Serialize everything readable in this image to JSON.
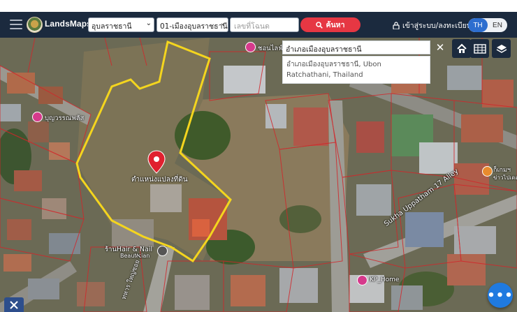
{
  "header": {
    "brand": "LandsMaps",
    "province": "อุบลราชธานี",
    "district": "01-เมืองอุบลราชธานี",
    "deed_placeholder": "เลขที่โฉนด",
    "search_label": "ค้นหา",
    "login_label": "เข้าสู่ระบบ/ลงทะเบียน",
    "lang_th": "TH",
    "lang_en": "EN"
  },
  "map_search": {
    "value": "อำเภอเมืองอุบลราชธานี",
    "suggestion": "อำเภอเมืองอุบลราชธานี, Ubon Ratchathani, Thailand"
  },
  "map": {
    "marker_label": "ตำแหน่งแปลงที่ดิน",
    "labels": {
      "poi_top": "ชอนไลฟ์",
      "poi_left": "บุญวรรณพลัส",
      "poi_bottom_left": "ร้านHair & Nail",
      "poi_bottom_left_sub": "Beautician",
      "poi_bottom": "KP_Home",
      "poi_right": "ก็เกมฯ",
      "poi_right_sub": "ข่าวไปเดอ",
      "road_right": "Sukha Uppatham 17 Alley",
      "road_bottom": "ทหาร ใหญ่ซอย 7"
    }
  },
  "fab_label": "•••",
  "colors": {
    "navbar": "#1b2a3e",
    "search_button": "#e63743",
    "lang_active": "#2d6ecf",
    "parcel_outline": "#f4d51e",
    "marker": "#e0202f",
    "fab": "#1f7ae0"
  },
  "icons": [
    "hamburger-icon",
    "logo-icon",
    "search-icon",
    "lock-icon",
    "close-icon",
    "home-icon",
    "grid-icon",
    "layers-icon",
    "tools-icon",
    "marker-icon"
  ]
}
